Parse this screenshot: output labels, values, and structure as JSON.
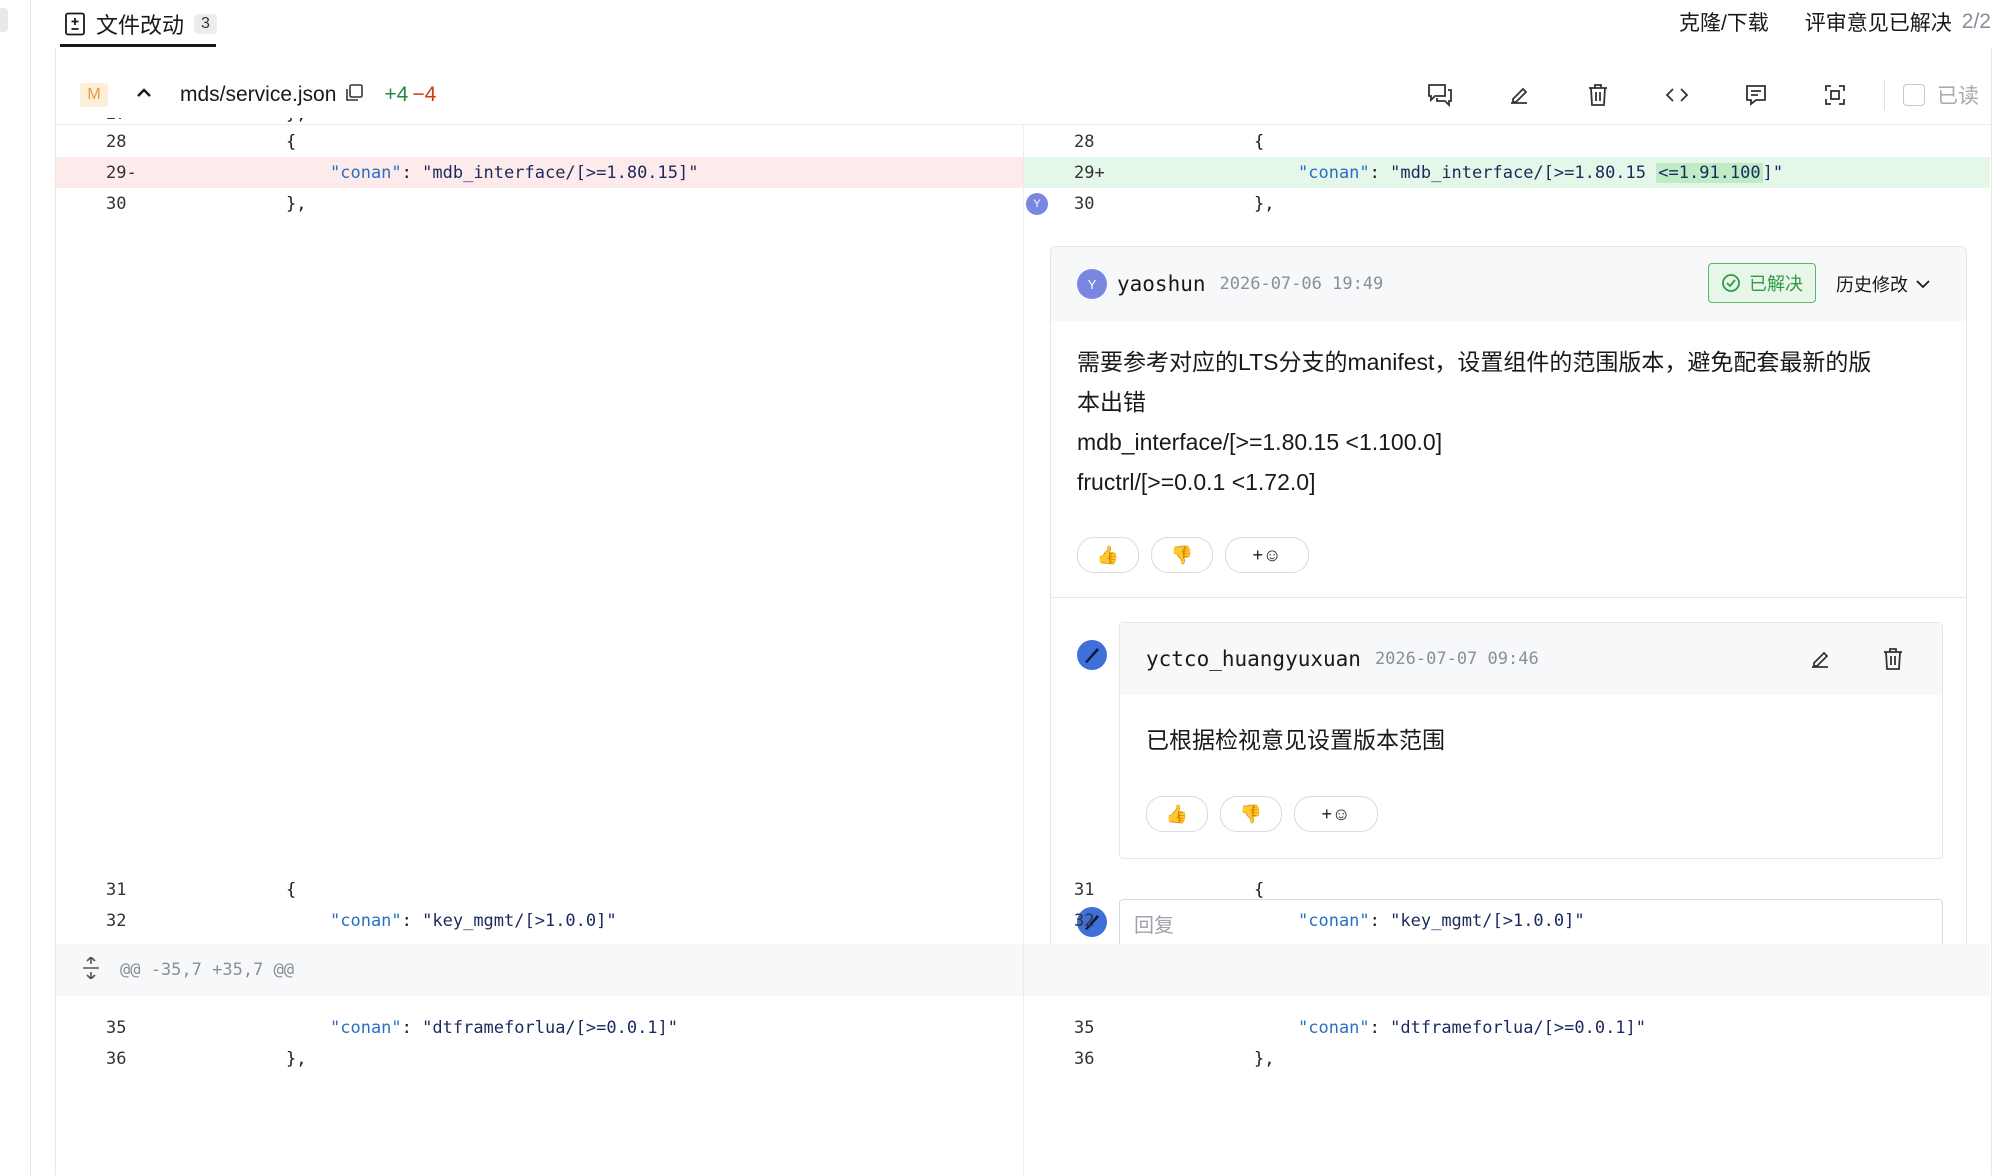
{
  "topbar": {
    "tab_label": "文件改动",
    "tab_count": "3",
    "clone_download": "克隆/下载",
    "review_resolved": "评审意见已解决",
    "review_ratio": "2/2"
  },
  "file": {
    "status": "M",
    "name": "mds/service.json",
    "additions": "+4",
    "deletions": "−4",
    "read_label": "已读"
  },
  "left_rows": [
    {
      "ln": "28",
      "code": "{"
    },
    {
      "ln": "29",
      "marker": "-",
      "code_key": "\"conan\"",
      "code_val": "\"mdb_interface/[>=1.80.15]\""
    },
    {
      "ln": "30",
      "code": "},"
    },
    {
      "ln": "31",
      "code": "{"
    },
    {
      "ln": "32",
      "code_key": "\"conan\"",
      "code_val": "\"key_mgmt/[>1.0.0]\""
    },
    {
      "ln": "35",
      "code_key": "\"conan\"",
      "code_val": "\"dtframeforlua/[>=0.0.1]\""
    },
    {
      "ln": "36",
      "code": "},"
    }
  ],
  "right_rows": [
    {
      "ln": "28",
      "code": "{"
    },
    {
      "ln": "29",
      "marker": "+",
      "code_key": "\"conan\"",
      "code_val_a": "\"mdb_interface/[>=1.80.15",
      "code_val_hl": "<=1.91.100",
      "code_val_b": "]\""
    },
    {
      "ln": "30",
      "code": "},"
    },
    {
      "ln": "31",
      "code": "{"
    },
    {
      "ln": "32",
      "code_key": "\"conan\"",
      "code_val": "\"key_mgmt/[>1.0.0]\""
    },
    {
      "ln": "35",
      "code_key": "\"conan\"",
      "code_val": "\"dtframeforlua/[>=0.0.1]\""
    },
    {
      "ln": "36",
      "code": "},"
    }
  ],
  "hunk_header": "@@ -35,7 +35,7 @@",
  "line_avatar_initial": "Y",
  "comment": {
    "avatar_initial": "Y",
    "author": "yaoshun",
    "time": "2026-07-06 19:49",
    "resolved_label": "已解决",
    "history_label": "历史修改",
    "body_line1": "需要参考对应的LTS分支的manifest，设置组件的范围版本，避免配套最新的版",
    "body_line2": "本出错",
    "body_line3": "mdb_interface/[>=1.80.15 <1.100.0]",
    "body_line4": "fructrl/[>=0.0.1 <1.72.0]",
    "reactions": [
      "👍",
      "👎",
      "+☺"
    ]
  },
  "reply": {
    "author": "yctco_huangyuxuan",
    "time": "2026-07-07 09:46",
    "body": "已根据检视意见设置版本范围",
    "reactions": [
      "👍",
      "👎",
      "+☺"
    ]
  },
  "reply_input": {
    "placeholder": "回复"
  }
}
